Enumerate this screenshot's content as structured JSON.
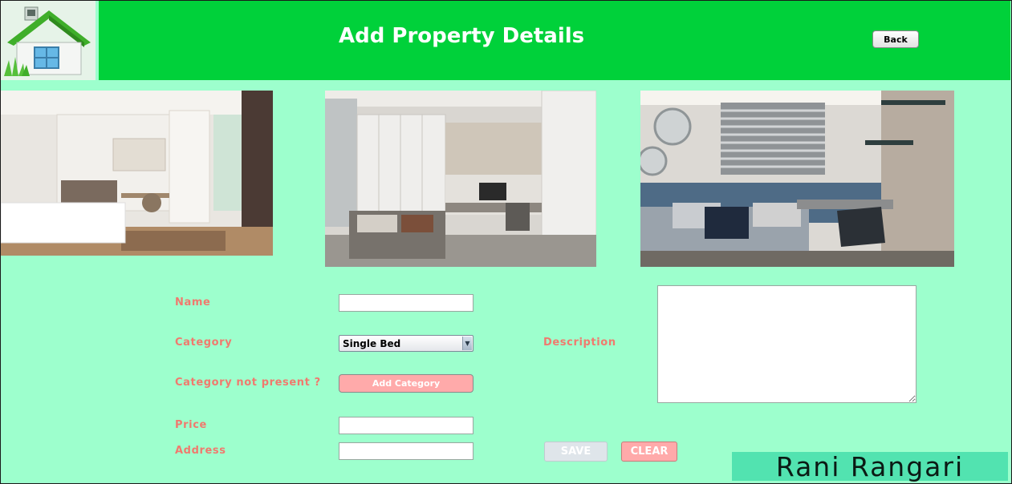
{
  "header": {
    "title": "Add Property Details",
    "back_label": "Back",
    "color": "#00d13a"
  },
  "form": {
    "name_label": "Name",
    "name_value": "",
    "category_label": "Category",
    "category_selected": "Single Bed",
    "category_missing_label": "Category not present ?",
    "add_category_label": "Add Category",
    "price_label": "Price",
    "price_value": "",
    "address_label": "Address",
    "address_value": "",
    "description_label": "Description",
    "description_value": "",
    "save_label": "SAVE",
    "clear_label": "CLEAR"
  },
  "watermark": "Rani Rangari",
  "colors": {
    "background": "#9dffcd",
    "label": "#f07a6e",
    "accent_button": "#ffaaaa"
  }
}
